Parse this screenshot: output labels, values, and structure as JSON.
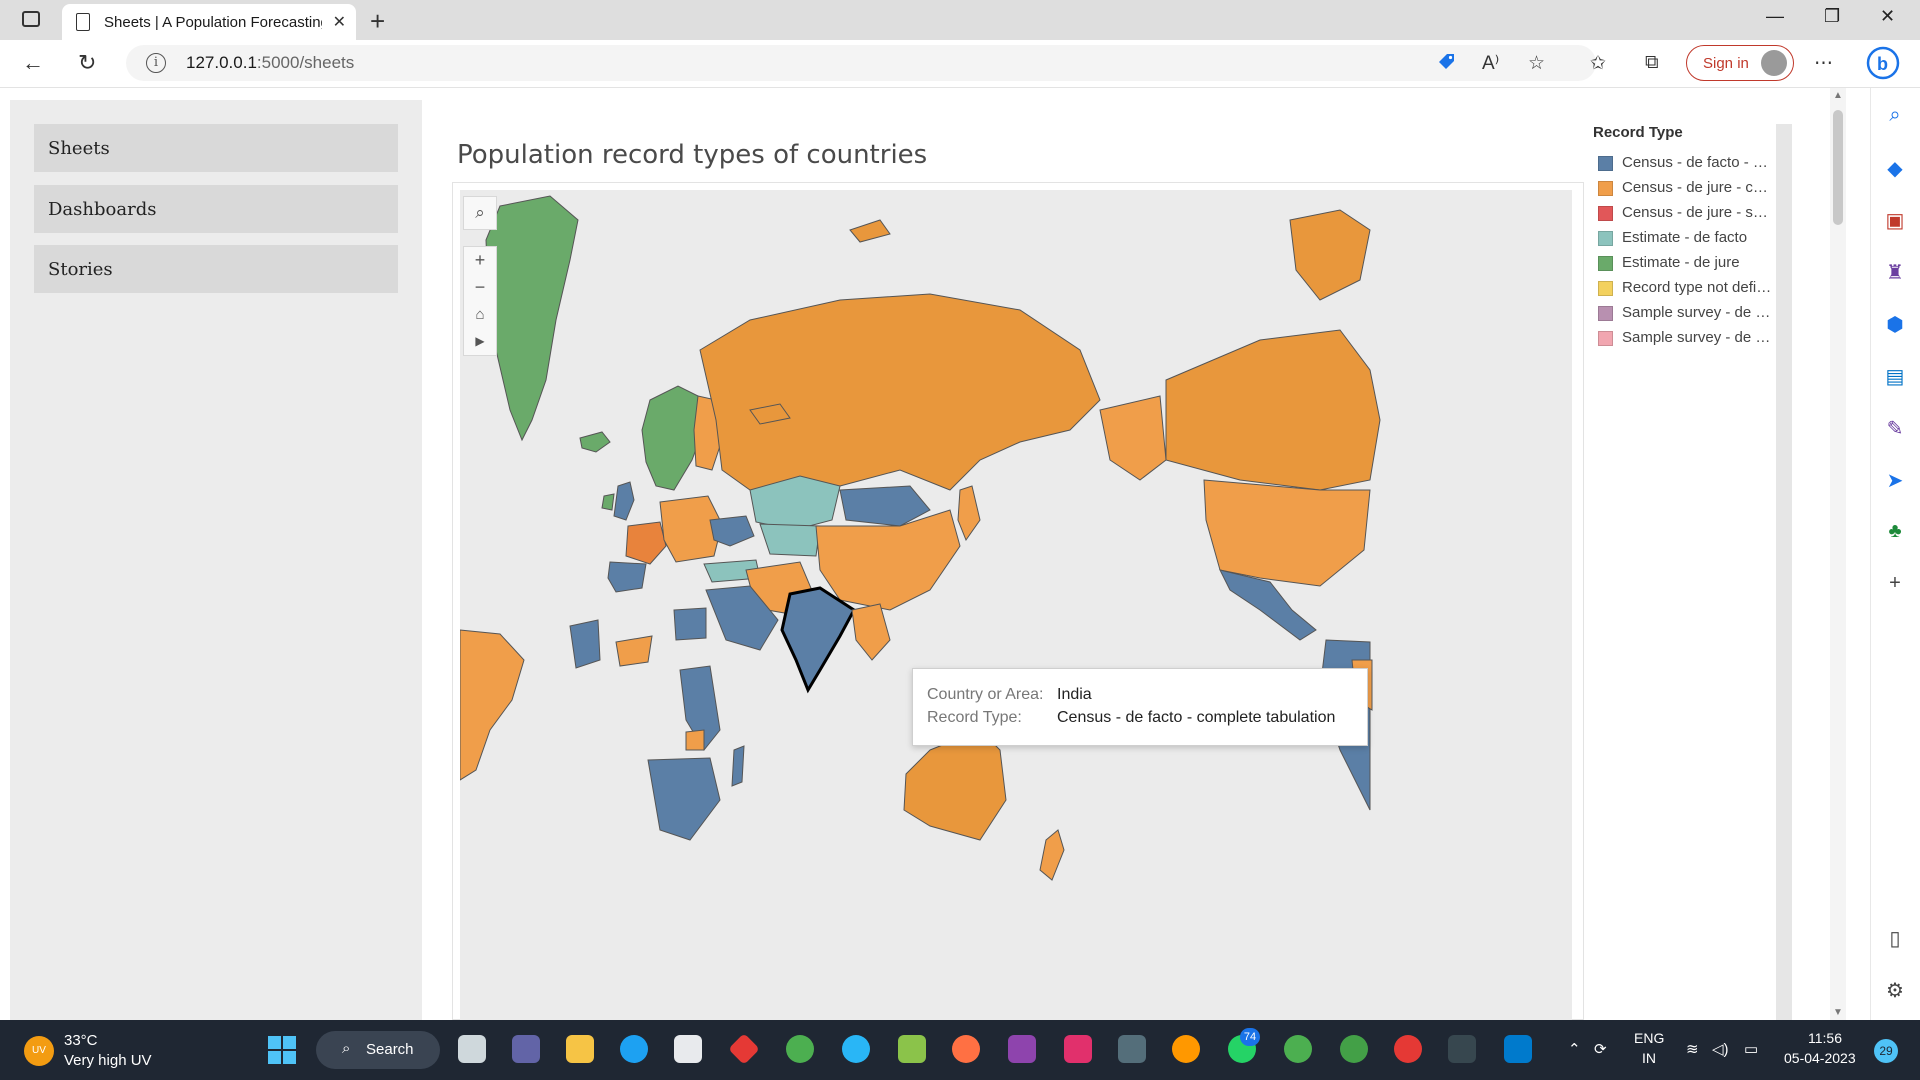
{
  "browser": {
    "tab_title": "Sheets | A Population Forecasting",
    "url_host": "127.0.0.1",
    "url_path": ":5000/sheets",
    "sign_in": "Sign in"
  },
  "nav": {
    "items": [
      "Sheets",
      "Dashboards",
      "Stories"
    ]
  },
  "chart": {
    "title": "Population record types of countries"
  },
  "legend": {
    "title": "Record Type",
    "items": [
      {
        "label": "Census - de facto - co...",
        "color": "#5b7fa6"
      },
      {
        "label": "Census - de jure - com...",
        "color": "#f09e4a"
      },
      {
        "label": "Census - de jure - sam...",
        "color": "#e15759"
      },
      {
        "label": "Estimate - de facto",
        "color": "#8cc3bd"
      },
      {
        "label": "Estimate - de jure",
        "color": "#6aaa6a"
      },
      {
        "label": "Record type not defin...",
        "color": "#f3d15e"
      },
      {
        "label": "Sample survey - de fa...",
        "color": "#b890b0"
      },
      {
        "label": "Sample survey - de jur...",
        "color": "#f1a6b0"
      }
    ]
  },
  "tooltip": {
    "country_key": "Country or Area:",
    "country_value": "India",
    "record_key": "Record Type:",
    "record_value": "Census - de facto - complete tabulation"
  },
  "taskbar": {
    "weather_temp": "33°C",
    "weather_desc": "Very high UV",
    "weather_badge": "UV",
    "search": "Search",
    "lang_1": "ENG",
    "lang_2": "IN",
    "time": "11:56",
    "date": "05-04-2023",
    "notif_count": "29",
    "whatsapp_badge": "74"
  },
  "colors": {
    "census_de_facto": "#5b7fa6",
    "census_de_jure": "#f09e4a",
    "estimate_de_facto": "#8cc3bd",
    "estimate_de_jure": "#6aaa6a",
    "census_de_jure_orange_dark": "#e8973c"
  }
}
